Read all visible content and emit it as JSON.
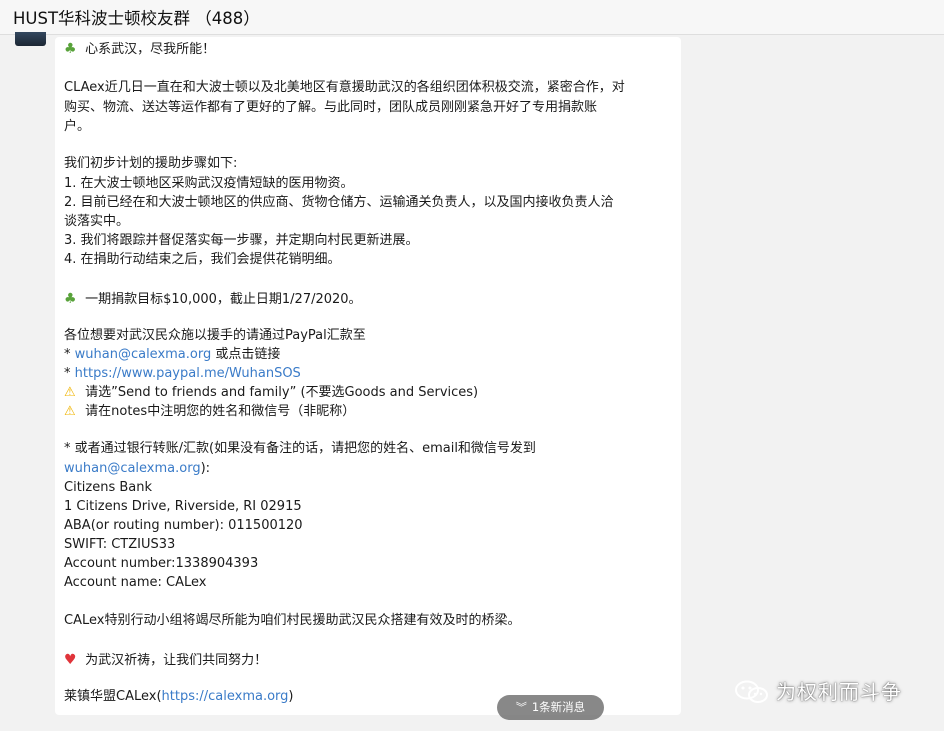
{
  "header": {
    "title": "HUST华科波士顿校友群 （488）"
  },
  "message": {
    "greeting": "心系武汉，尽我所能！",
    "intro_1": "CLAex近几日一直在和大波士顿以及北美地区有意援助武汉的各组织团体积极交流，紧密合作，对",
    "intro_2": "购买、物流、送达等运作都有了更好的了解。与此同时，团队成员刚刚紧急开好了专用捐款账",
    "intro_3": "户。",
    "steps_title": "我们初步计划的援助步骤如下:",
    "step_1": "1. 在大波士顿地区采购武汉疫情短缺的医用物资。",
    "step_2a": "2. 目前已经在和大波士顿地区的供应商、货物仓储方、运输通关负责人，以及国内接收负责人洽",
    "step_2b": "谈落实中。",
    "step_3": "3. 我们将跟踪并督促落实每一步骤，并定期向村民更新进展。",
    "step_4": "4. 在捐助行动结束之后，我们会提供花销明细。",
    "goal": "一期捐款目标$10,000，截止日期1/27/2020。",
    "paypal_intro": "各位想要对武汉民众施以援手的请通过PayPal汇款至",
    "bullet": "*",
    "paypal_email": "wuhan@calexma.org",
    "paypal_email_suffix": "或点击链接",
    "paypal_link": "https://www.paypal.me/WuhanSOS",
    "warn_1": "请选”Send to friends and family” (不要选Goods and Services)",
    "warn_2": "请在notes中注明您的姓名和微信号（非昵称）",
    "bank_intro": "* 或者通过银行转账/汇款(如果没有备注的话，请把您的姓名、email和微信号发到",
    "bank_email": "wuhan@calexma.org",
    "bank_email_suffix": "):",
    "bank_name": "Citizens Bank",
    "bank_address": "1 Citizens Drive, Riverside, RI 02915",
    "aba": "ABA(or routing number): 011500120",
    "swift": "SWIFT: CTZIUS33",
    "account_number": "Account number:1338904393",
    "account_name": "Account name: CALex",
    "closing": "CALex特别行动小组将竭尽所能为咱们村民援助武汉民众搭建有效及时的桥梁。",
    "prayer": "为武汉祈祷，让我们共同努力！",
    "signature": "莱镇华盟CALex",
    "signature_link": "https://calexma.org",
    "signature_open": "(",
    "signature_close": ")"
  },
  "new_messages": {
    "label": "1条新消息"
  },
  "watermark": {
    "text": "为权利而斗争"
  },
  "icons": {
    "leaf": "four-leaf-clover-icon",
    "warning": "warning-icon",
    "heart": "red-heart-icon",
    "chevron": "double-chevron-down-icon",
    "wechat": "wechat-official-account-icon"
  },
  "colors": {
    "link": "#3a7bc8",
    "bubble": "#ffffff",
    "background": "#f2f2f2"
  }
}
